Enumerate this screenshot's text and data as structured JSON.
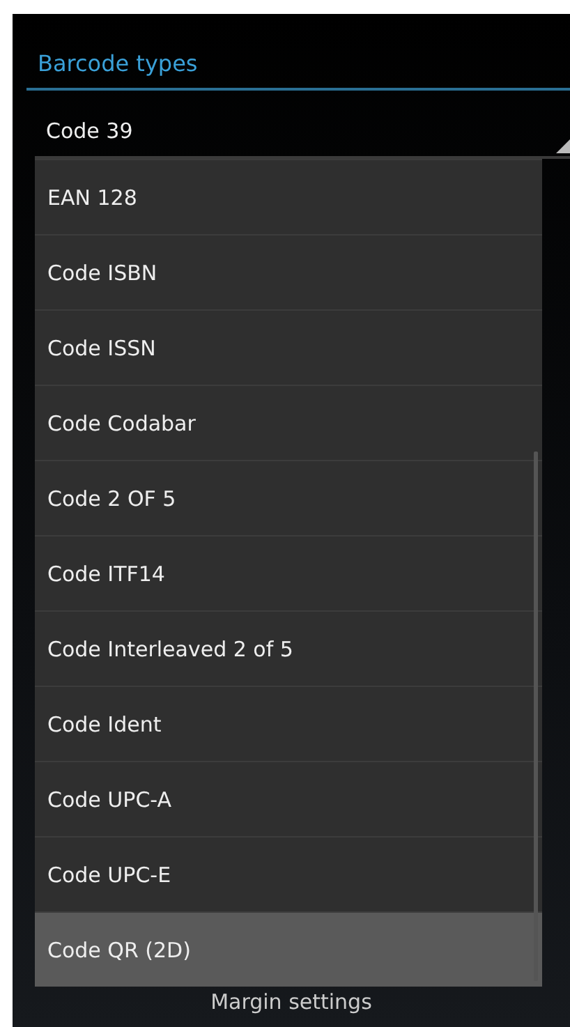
{
  "section_title": "Barcode types",
  "spinner": {
    "value": "Code 39"
  },
  "dropdown": {
    "items": [
      {
        "label": "EAN 128",
        "selected": false
      },
      {
        "label": "Code ISBN",
        "selected": false
      },
      {
        "label": "Code ISSN",
        "selected": false
      },
      {
        "label": "Code Codabar",
        "selected": false
      },
      {
        "label": "Code 2 OF 5",
        "selected": false
      },
      {
        "label": "Code ITF14",
        "selected": false
      },
      {
        "label": "Code Interleaved 2 of 5",
        "selected": false
      },
      {
        "label": "Code Ident",
        "selected": false
      },
      {
        "label": "Code UPC-A",
        "selected": false
      },
      {
        "label": "Code UPC-E",
        "selected": false
      },
      {
        "label": "Code QR (2D)",
        "selected": true
      }
    ]
  },
  "footer_label": "Margin settings"
}
